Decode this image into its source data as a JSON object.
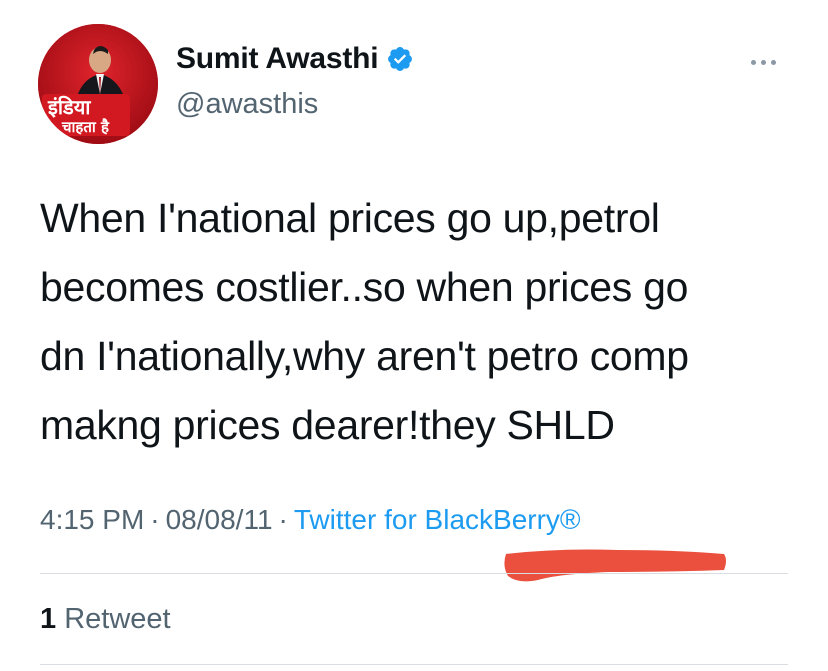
{
  "author": {
    "display_name": "Sumit Awasthi",
    "handle": "@awasthis",
    "avatar_badge_line1": "इंडिया",
    "avatar_badge_line2": "चाहता है",
    "verified_icon": "verified-badge-icon"
  },
  "tweet": {
    "text": "When I'national prices go up,petrol\nbecomes costlier..so when prices go\ndn I'nationally,why aren't petro comp\nmakng prices dearer!they  SHLD"
  },
  "meta": {
    "time": "4:15 PM",
    "separator": "·",
    "date": "08/08/11",
    "source": "Twitter for BlackBerry®"
  },
  "stats": {
    "retweet_count": "1",
    "retweet_label": "Retweet"
  },
  "colors": {
    "link_blue": "#1d9bf0",
    "secondary_text": "#536471",
    "redaction_red": "#e8412c",
    "avatar_red": "#c8101a"
  }
}
